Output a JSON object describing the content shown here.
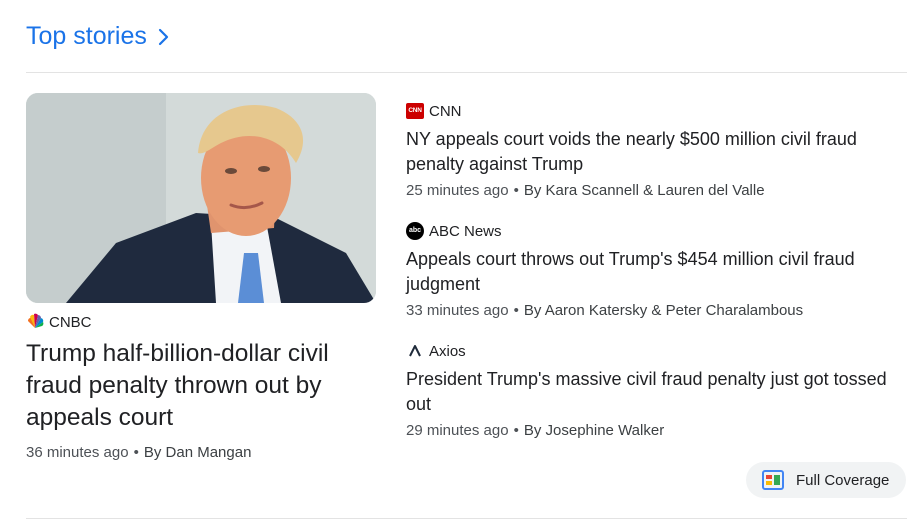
{
  "header": {
    "title": "Top stories"
  },
  "featured": {
    "source": "CNBC",
    "headline": "Trump half-billion-dollar civil fraud penalty thrown out by appeals court",
    "time": "36 minutes ago",
    "byline": "By Dan Mangan"
  },
  "stories": [
    {
      "source": "CNN",
      "logo_text": "CNN",
      "headline": "NY appeals court voids the nearly $500 million civil fraud penalty against Trump",
      "time": "25 minutes ago",
      "byline": "By Kara Scannell & Lauren del Valle"
    },
    {
      "source": "ABC News",
      "logo_text": "abc",
      "headline": "Appeals court throws out Trump's $454 million civil fraud judgment",
      "time": "33 minutes ago",
      "byline": "By Aaron Katersky & Peter Charalambous"
    },
    {
      "source": "Axios",
      "headline": "President Trump's massive civil fraud penalty just got tossed out",
      "time": "29 minutes ago",
      "byline": "By Josephine Walker"
    }
  ],
  "full_coverage": {
    "label": "Full Coverage"
  },
  "separator": "•",
  "colors": {
    "link_blue": "#1a73e8",
    "cnn_red": "#cc0000",
    "text": "#202124",
    "meta": "#4d5156"
  }
}
